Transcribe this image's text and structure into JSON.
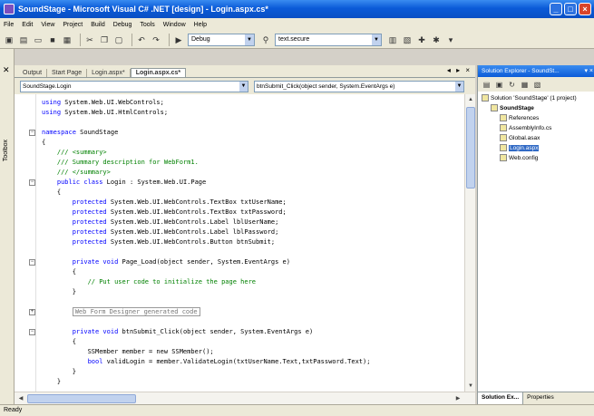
{
  "window": {
    "title": "SoundStage - Microsoft Visual C# .NET [design] - Login.aspx.cs*",
    "controls": {
      "minimize": "_",
      "maximize": "□",
      "close": "×"
    }
  },
  "menu": [
    "File",
    "Edit",
    "View",
    "Project",
    "Build",
    "Debug",
    "Tools",
    "Window",
    "Help"
  ],
  "toolbar": {
    "config_combo": "Debug",
    "find_combo": "text.secure"
  },
  "toolbox": {
    "label": "Toolbox"
  },
  "tabs": [
    "Output",
    "Start Page",
    "Login.aspx*",
    "Login.aspx.cs*"
  ],
  "tab_controls": "◂ ▸ ×",
  "dropdowns": {
    "class": "SoundStage.Login",
    "member": "btnSubmit_Click(object sender, System.EventArgs e)"
  },
  "code": [
    {
      "k": "using",
      "t": " System.Web.UI.WebControls;"
    },
    {
      "k": "using",
      "t": " System.Web.UI.HtmlControls;"
    },
    {
      "k": "",
      "t": ""
    },
    {
      "k": "namespace",
      "t": " SoundStage"
    },
    {
      "k": "",
      "t": "{"
    },
    {
      "c": "    /// <summary>"
    },
    {
      "c": "    /// Summary description for WebForm1."
    },
    {
      "c": "    /// </summary>"
    },
    {
      "k": "    public class",
      "t": " Login : System.Web.UI.Page"
    },
    {
      "k": "",
      "t": "    {"
    },
    {
      "k": "        protected",
      "t": " System.Web.UI.WebControls.TextBox txtUserName;"
    },
    {
      "k": "        protected",
      "t": " System.Web.UI.WebControls.TextBox txtPassword;"
    },
    {
      "k": "        protected",
      "t": " System.Web.UI.WebControls.Label lblUserName;"
    },
    {
      "k": "        protected",
      "t": " System.Web.UI.WebControls.Label lblPassword;"
    },
    {
      "k": "        protected",
      "t": " System.Web.UI.WebControls.Button btnSubmit;"
    },
    {
      "k": "",
      "t": ""
    },
    {
      "k": "        private void",
      "t": " Page_Load(object sender, System.EventArgs e)"
    },
    {
      "k": "",
      "t": "        {"
    },
    {
      "c": "            // Put user code to initialize the page here"
    },
    {
      "k": "",
      "t": "        }"
    },
    {
      "k": "",
      "t": ""
    },
    {
      "r": "Web Form Designer generated code"
    },
    {
      "k": "",
      "t": ""
    },
    {
      "k": "        private void",
      "t": " btnSubmit_Click(object sender, System.EventArgs e)"
    },
    {
      "k": "",
      "t": "        {"
    },
    {
      "k": "",
      "t": "            SSMember member = new SSMember();"
    },
    {
      "k": "            bool",
      "t": " validLogin = member.ValidateLogin(txtUserName.Text,txtPassword.Text);"
    },
    {
      "k": "",
      "t": "        }"
    },
    {
      "k": "",
      "t": "    }"
    }
  ],
  "solution_explorer": {
    "title": "Solution Explorer - SoundSt...",
    "header_buttons": "▾ ×",
    "items": [
      {
        "label": "Solution 'SoundStage' (1 project)",
        "depth": 0
      },
      {
        "label": "SoundStage",
        "depth": 1,
        "bold": true
      },
      {
        "label": "References",
        "depth": 2
      },
      {
        "label": "AssemblyInfo.cs",
        "depth": 2
      },
      {
        "label": "Global.asax",
        "depth": 2
      },
      {
        "label": "Login.aspx",
        "depth": 2,
        "selected": true
      },
      {
        "label": "Web.config",
        "depth": 2
      }
    ],
    "bottom_tabs": [
      "Solution Ex...",
      "Properties"
    ]
  },
  "status": "Ready"
}
